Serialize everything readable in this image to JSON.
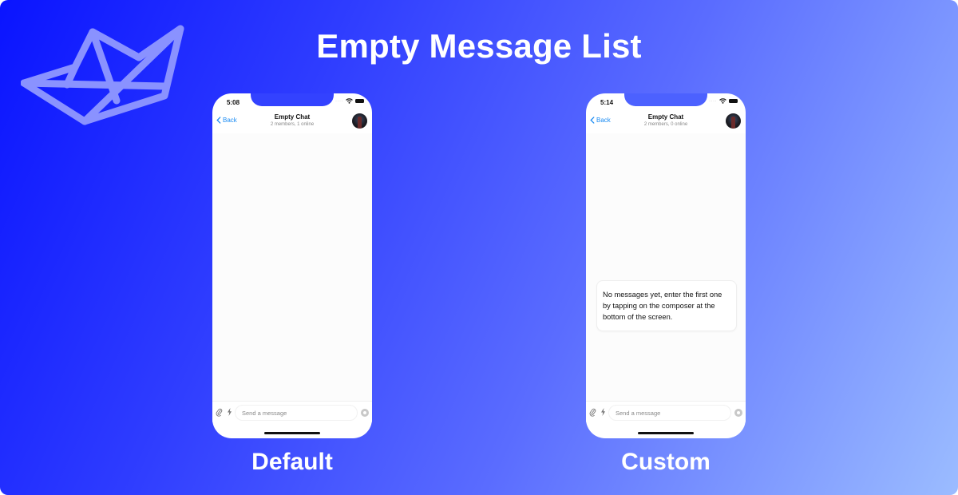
{
  "page": {
    "title": "Empty Message List",
    "logo": "paper-boat-logo",
    "colors": {
      "accent_link": "#1a8bf3",
      "background_start": "#0a14ff",
      "background_end": "#9bbcff",
      "logo": "#8a92ff"
    }
  },
  "phones": [
    {
      "caption": "Default",
      "status": {
        "time": "5:08",
        "icons": [
          "signal-dots-icon",
          "wifi-icon",
          "battery-icon"
        ]
      },
      "header": {
        "back_label": "Back",
        "title": "Empty Chat",
        "subtitle": "2 members, 1 online"
      },
      "empty_state": null,
      "composer": {
        "placeholder": "Send a message"
      }
    },
    {
      "caption": "Custom",
      "status": {
        "time": "5:14",
        "icons": [
          "signal-dots-icon",
          "wifi-icon",
          "battery-icon"
        ]
      },
      "header": {
        "back_label": "Back",
        "title": "Empty Chat",
        "subtitle": "2 members, 0 online"
      },
      "empty_state": {
        "text": "No messages yet, enter the first one by tapping on the composer at the bottom of the screen."
      },
      "composer": {
        "placeholder": "Send a message"
      }
    }
  ]
}
